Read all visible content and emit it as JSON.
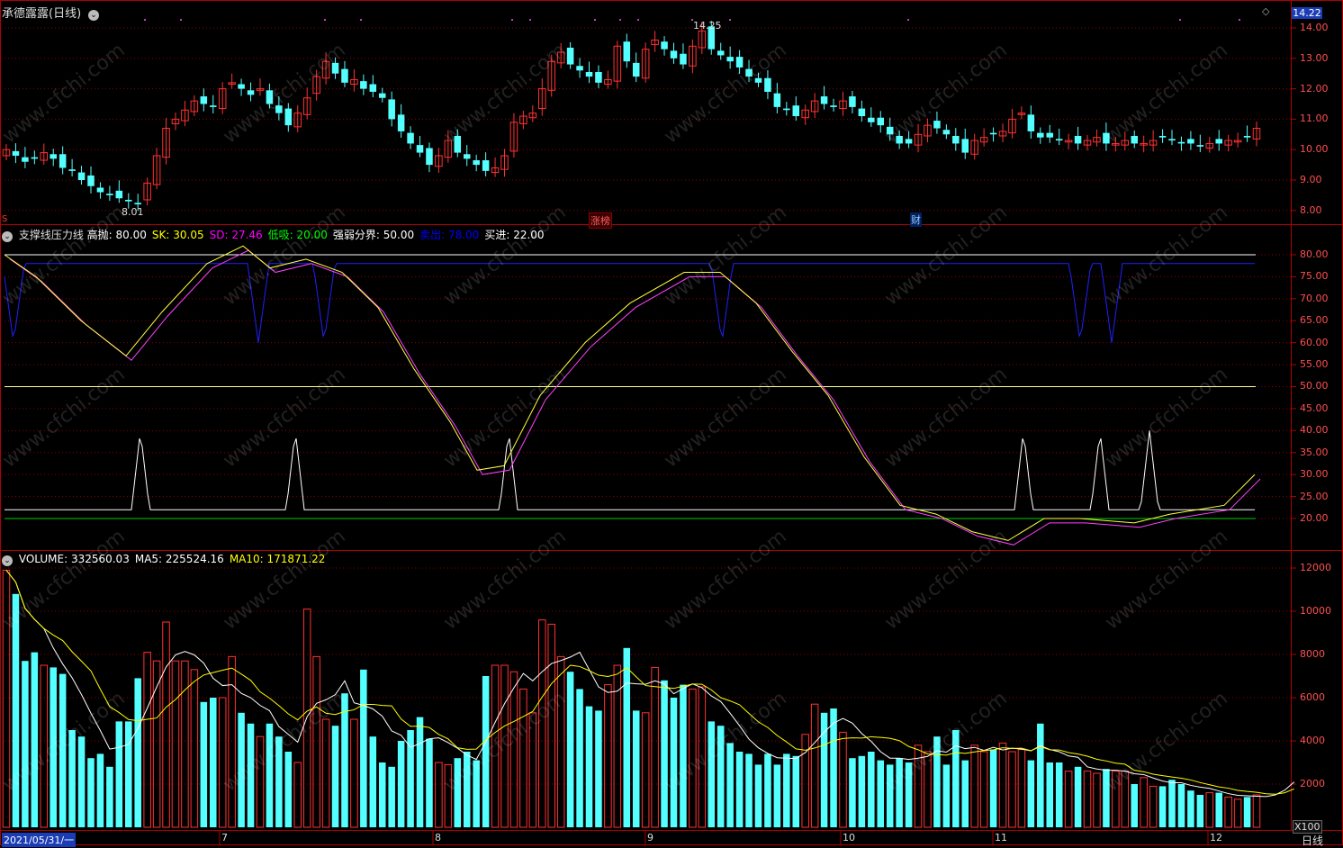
{
  "price_panel": {
    "title": "承德露露(日线)",
    "max_label": "14.25",
    "min_label": "8.01",
    "current_price": "14.22",
    "y_ticks": [
      "14.00",
      "13.00",
      "12.00",
      "11.00",
      "10.00",
      "9.00",
      "8.00"
    ],
    "markers": {
      "zhangbang": "涨榜",
      "cai": "财"
    },
    "s_marker": "S"
  },
  "indicator_panel": {
    "name": "支撑线压力线",
    "items": [
      {
        "label": "高抛:",
        "value": "80.00",
        "color": "#ffffff"
      },
      {
        "label": "SK:",
        "value": "30.05",
        "color": "#ffff00"
      },
      {
        "label": "SD:",
        "value": "27.46",
        "color": "#ff00ff"
      },
      {
        "label": "低吸:",
        "value": "20.00",
        "color": "#00ff00"
      },
      {
        "label": "强弱分界:",
        "value": "50.00",
        "color": "#ffffff"
      },
      {
        "label": "卖出:",
        "value": "78.00",
        "color": "#0000ff"
      },
      {
        "label": "买进:",
        "value": "22.00",
        "color": "#ffffff"
      }
    ],
    "y_ticks": [
      "80.00",
      "75.00",
      "70.00",
      "65.00",
      "60.00",
      "55.00",
      "50.00",
      "45.00",
      "40.00",
      "35.00",
      "30.00",
      "25.00",
      "20.00"
    ]
  },
  "volume_panel": {
    "items": [
      {
        "label": "VOLUME:",
        "value": "332560.03",
        "color": "#ffffff"
      },
      {
        "label": "MA5:",
        "value": "225524.16",
        "color": "#ffffff"
      },
      {
        "label": "MA10:",
        "value": "171871.22",
        "color": "#ffff00"
      }
    ],
    "y_ticks": [
      "12000",
      "10000",
      "8000",
      "6000",
      "4000",
      "2000"
    ],
    "unit": "X100"
  },
  "time_axis": {
    "start_date": "2021/05/31/一",
    "months": [
      "7",
      "8",
      "9",
      "10",
      "11",
      "12"
    ],
    "period": "日线"
  },
  "watermark": "www.cfchi.com",
  "colors": {
    "up": "#ff3232",
    "down": "#54ffff",
    "grid": "#8b0000",
    "border": "#b00000",
    "ma5": "#ffffff",
    "ma10": "#ffff00"
  }
}
